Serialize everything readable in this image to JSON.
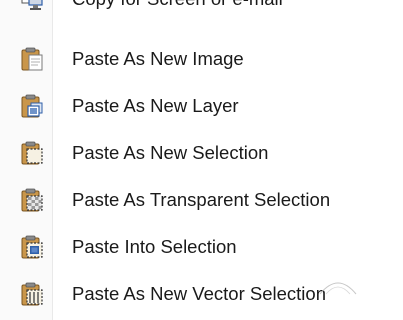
{
  "menu": {
    "items": [
      {
        "label": "Copy for Screen or e-mail",
        "icon": "copy-screen-icon"
      },
      {
        "label": "Paste As New Image",
        "icon": "paste-new-image-icon"
      },
      {
        "label": "Paste As New Layer",
        "icon": "paste-new-layer-icon"
      },
      {
        "label": "Paste As New Selection",
        "icon": "paste-new-selection-icon"
      },
      {
        "label": "Paste As Transparent Selection",
        "icon": "paste-transparent-selection-icon"
      },
      {
        "label": "Paste Into Selection",
        "icon": "paste-into-selection-icon"
      },
      {
        "label": "Paste As New Vector Selection",
        "icon": "paste-vector-selection-icon"
      }
    ]
  },
  "colors": {
    "clipboard_body": "#b98a3c",
    "clipboard_clip": "#6b6b6b",
    "paper": "#ffffff",
    "accent_blue": "#2f5fa8"
  }
}
